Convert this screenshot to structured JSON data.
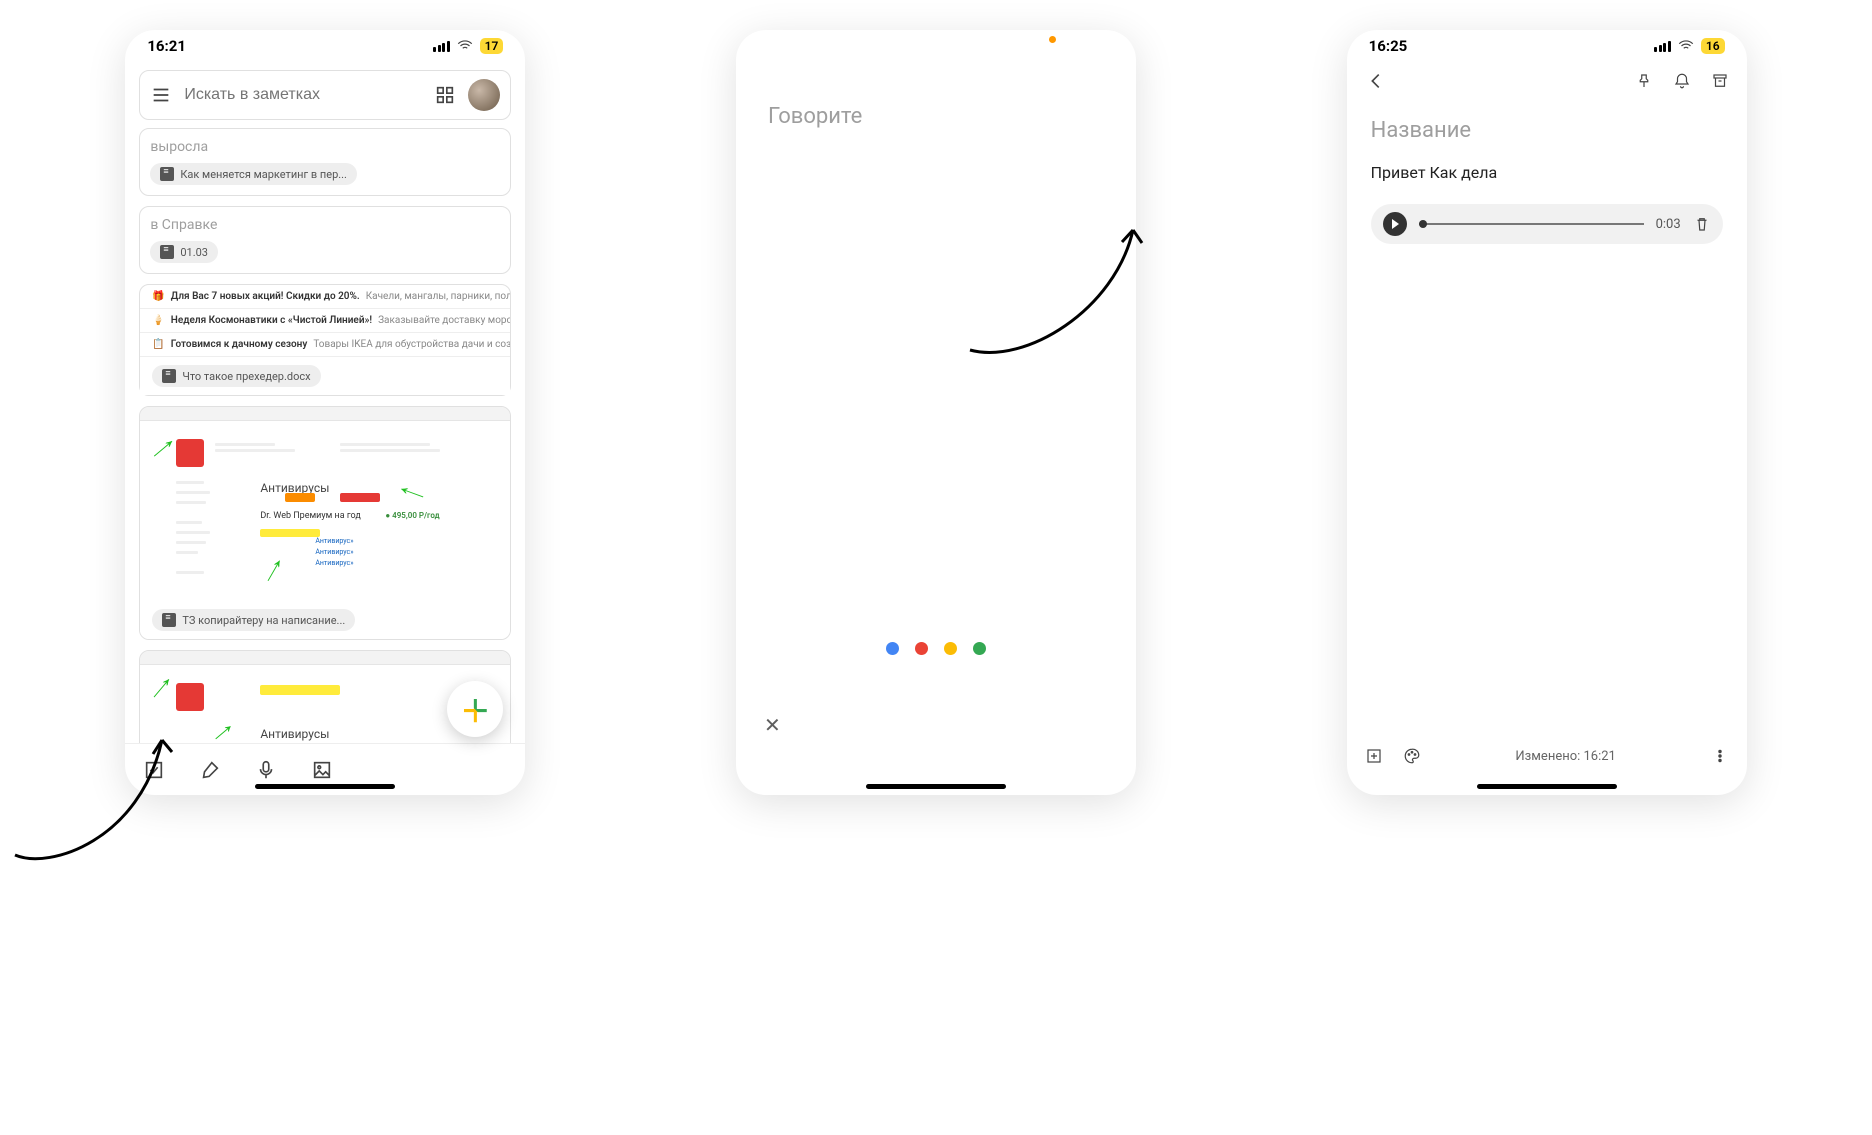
{
  "phone1": {
    "status": {
      "time": "16:21",
      "battery": "17"
    },
    "search": {
      "placeholder": "Искать в заметках"
    },
    "note_grown": {
      "title": "выросла",
      "chip": "Как меняется маркетинг в пер..."
    },
    "note_spravka": {
      "title": "в Справке",
      "chip": "01.03"
    },
    "promo": {
      "r1_bold": "Для Вас 7 новых акций! Скидки до 20%.",
      "r1_tail": "Качели, мангалы, парники, полотен",
      "r2_bold": "Неделя Космонавтики с «Чистой Линией»!",
      "r2_tail": "Заказывайте доставку морож",
      "r3_bold": "Готовимся к дачному сезону",
      "r3_tail": "Товары IKEA для обустройства дачи и создания уг",
      "attach": "Что такое прехедер.docx"
    },
    "screenshot1": {
      "heading": "Антивирусы",
      "product": "Dr. Web Премиум на год",
      "price": "495,00 Р/год",
      "chip": "ТЗ копирайтеру на написание..."
    },
    "screenshot2": {
      "heading": "Антивирусы"
    }
  },
  "phone2": {
    "prompt": "Говорите",
    "dots": [
      "#4285f4",
      "#ea4335",
      "#fbbc05",
      "#34a853"
    ]
  },
  "phone3": {
    "status": {
      "time": "16:25",
      "battery": "16"
    },
    "title_placeholder": "Название",
    "body": "Привет Как дела",
    "audio_time": "0:03",
    "edited": "Изменено: 16:21"
  }
}
